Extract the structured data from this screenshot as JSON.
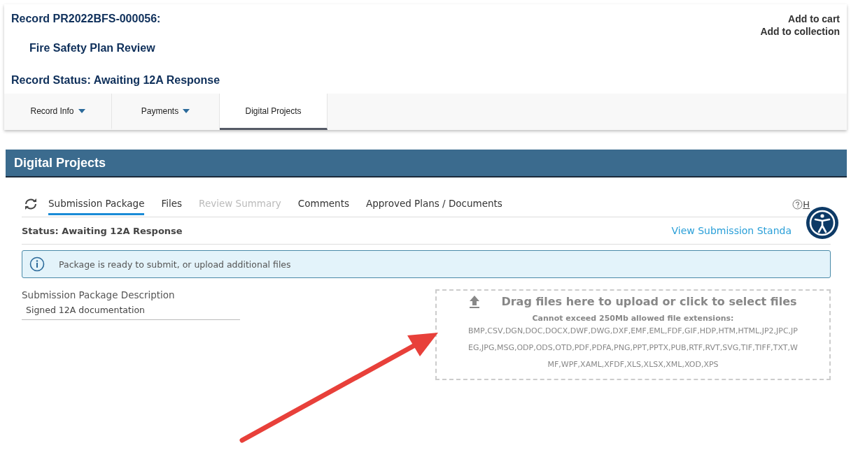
{
  "record": {
    "number": "Record PR2022BFS-000056:",
    "type": "Fire Safety Plan Review",
    "status": "Record Status: Awaiting 12A Response"
  },
  "actions": [
    "Add to cart",
    "Add to collection"
  ],
  "record_tabs": [
    {
      "label": "Record Info",
      "dropdown": true,
      "selected": false
    },
    {
      "label": "Payments",
      "dropdown": true,
      "selected": false
    },
    {
      "label": "Digital Projects",
      "dropdown": false,
      "selected": true
    }
  ],
  "section_title": "Digital Projects",
  "project_tabs": [
    {
      "label": "Submission Package",
      "selected": true,
      "disabled": false
    },
    {
      "label": "Files",
      "selected": false,
      "disabled": false
    },
    {
      "label": "Review Summary",
      "selected": false,
      "disabled": true
    },
    {
      "label": "Comments",
      "selected": false,
      "disabled": false
    },
    {
      "label": "Approved Plans / Documents",
      "selected": false,
      "disabled": false
    }
  ],
  "help": "H",
  "status": "Status: Awaiting 12A Response",
  "standards_link": "View Submission Standa",
  "info_message": "Package is ready to submit, or upload additional files",
  "description": {
    "label": "Submission Package Description",
    "value": "Signed 12A documentation"
  },
  "upload": {
    "title": "Drag files here to upload or click to select files",
    "limit": "Cannot exceed 250Mb allowed file extensions:",
    "extension_lines": [
      "BMP,CSV,DGN,DOC,DOCX,DWF,DWG,DXF,EMF,EML,FDF,GIF,HDP,HTM,HTML,JP2,JPC,JP",
      "EG,JPG,MSG,ODP,ODS,OTD,PDF,PDFA,PNG,PPT,PPTX,PUB,RTF,RVT,SVG,TIF,TIFF,TXT,W",
      "MF,WPF,XAML,XFDF,XLS,XLSX,XML,XOD,XPS"
    ]
  }
}
